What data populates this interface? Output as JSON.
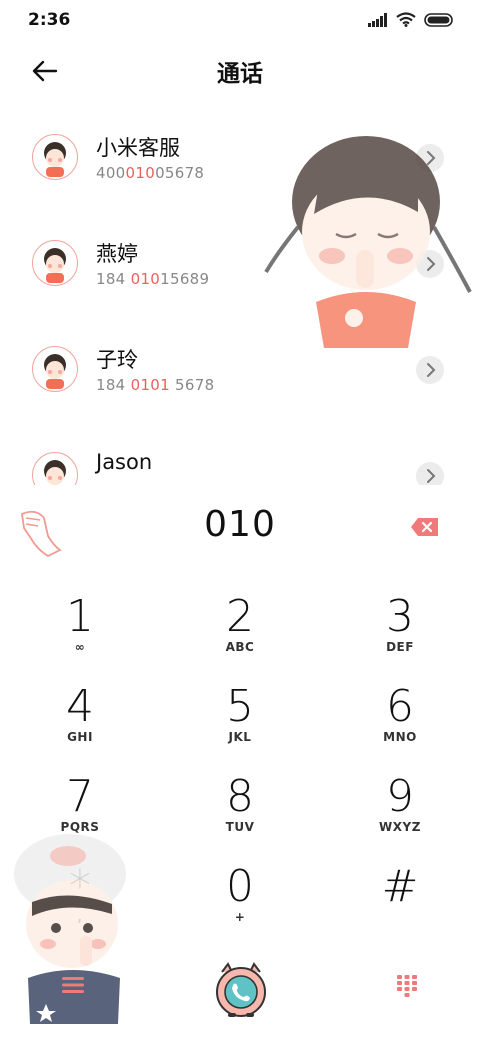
{
  "status": {
    "time": "2:36"
  },
  "header": {
    "title": "通话"
  },
  "contacts": [
    {
      "name": "小米客服",
      "number_parts": [
        "400",
        "010",
        "05678"
      ]
    },
    {
      "name": "燕婷",
      "number_parts": [
        "184 ",
        "010",
        "15689"
      ]
    },
    {
      "name": "子玲",
      "number_parts": [
        "184 ",
        "0101",
        " 5678"
      ]
    },
    {
      "name": "Jason",
      "number_parts": [
        "",
        "",
        ""
      ]
    }
  ],
  "dialer": {
    "number": "010"
  },
  "keys": [
    {
      "digit": "1",
      "letters": "∞"
    },
    {
      "digit": "2",
      "letters": "ABC"
    },
    {
      "digit": "3",
      "letters": "DEF"
    },
    {
      "digit": "4",
      "letters": "GHI"
    },
    {
      "digit": "5",
      "letters": "JKL"
    },
    {
      "digit": "6",
      "letters": "MNO"
    },
    {
      "digit": "7",
      "letters": "PQRS"
    },
    {
      "digit": "8",
      "letters": "TUV"
    },
    {
      "digit": "9",
      "letters": "WXYZ"
    },
    {
      "digit": "*",
      "letters": ","
    },
    {
      "digit": "0",
      "letters": "+"
    },
    {
      "digit": "#",
      "letters": ""
    }
  ],
  "colors": {
    "accent": "#e8625d",
    "icon_pink": "#f07a7a"
  }
}
